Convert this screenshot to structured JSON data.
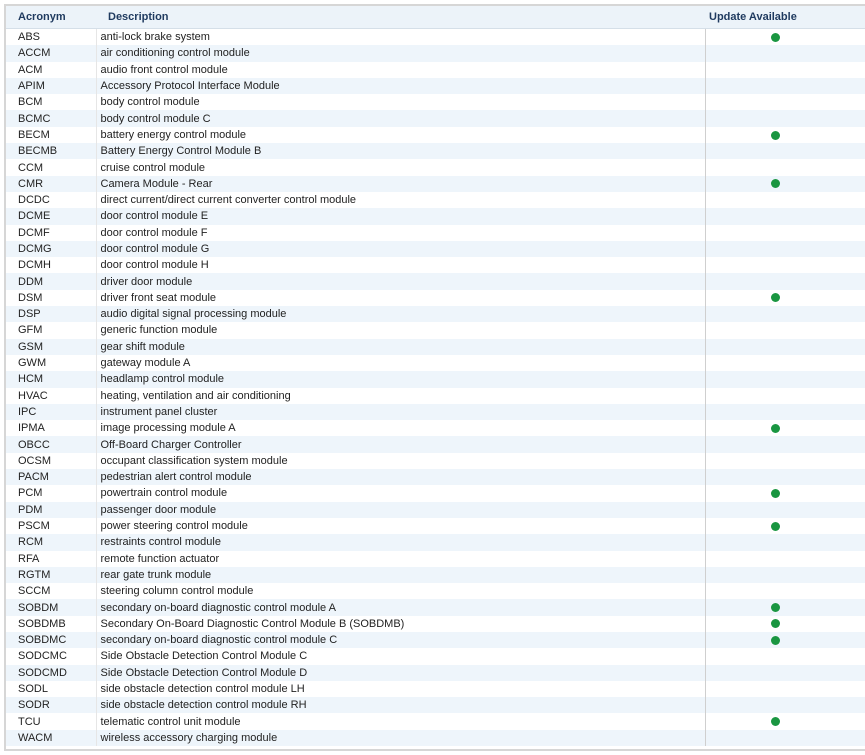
{
  "table": {
    "headers": {
      "acronym": "Acronym",
      "description": "Description",
      "update": "Update Available"
    },
    "update_indicator_color": "#1a9641",
    "rows": [
      {
        "acronym": "ABS",
        "description": "anti-lock brake system",
        "update": true
      },
      {
        "acronym": "ACCM",
        "description": "air conditioning control module",
        "update": false
      },
      {
        "acronym": "ACM",
        "description": "audio front control module",
        "update": false
      },
      {
        "acronym": "APIM",
        "description": "Accessory Protocol Interface Module",
        "update": false
      },
      {
        "acronym": "BCM",
        "description": "body control module",
        "update": false
      },
      {
        "acronym": "BCMC",
        "description": "body control module C",
        "update": false
      },
      {
        "acronym": "BECM",
        "description": "battery energy control module",
        "update": true
      },
      {
        "acronym": "BECMB",
        "description": "Battery Energy Control Module B",
        "update": false
      },
      {
        "acronym": "CCM",
        "description": "cruise control module",
        "update": false
      },
      {
        "acronym": "CMR",
        "description": "Camera Module - Rear",
        "update": true
      },
      {
        "acronym": "DCDC",
        "description": "direct current/direct current converter control module",
        "update": false
      },
      {
        "acronym": "DCME",
        "description": "door control module E",
        "update": false
      },
      {
        "acronym": "DCMF",
        "description": "door control module F",
        "update": false
      },
      {
        "acronym": "DCMG",
        "description": "door control module G",
        "update": false
      },
      {
        "acronym": "DCMH",
        "description": "door control module H",
        "update": false
      },
      {
        "acronym": "DDM",
        "description": "driver door module",
        "update": false
      },
      {
        "acronym": "DSM",
        "description": "driver front seat module",
        "update": true
      },
      {
        "acronym": "DSP",
        "description": "audio digital signal processing module",
        "update": false
      },
      {
        "acronym": "GFM",
        "description": "generic function module",
        "update": false
      },
      {
        "acronym": "GSM",
        "description": "gear shift module",
        "update": false
      },
      {
        "acronym": "GWM",
        "description": "gateway module A",
        "update": false
      },
      {
        "acronym": "HCM",
        "description": "headlamp control module",
        "update": false
      },
      {
        "acronym": "HVAC",
        "description": "heating, ventilation and air conditioning",
        "update": false
      },
      {
        "acronym": "IPC",
        "description": "instrument panel cluster",
        "update": false
      },
      {
        "acronym": "IPMA",
        "description": "image processing module A",
        "update": true
      },
      {
        "acronym": "OBCC",
        "description": "Off-Board Charger Controller",
        "update": false
      },
      {
        "acronym": "OCSM",
        "description": "occupant classification system module",
        "update": false
      },
      {
        "acronym": "PACM",
        "description": "pedestrian alert control module",
        "update": false
      },
      {
        "acronym": "PCM",
        "description": "powertrain control module",
        "update": true
      },
      {
        "acronym": "PDM",
        "description": "passenger door module",
        "update": false
      },
      {
        "acronym": "PSCM",
        "description": "power steering control module",
        "update": true
      },
      {
        "acronym": "RCM",
        "description": "restraints control module",
        "update": false
      },
      {
        "acronym": "RFA",
        "description": "remote function actuator",
        "update": false
      },
      {
        "acronym": "RGTM",
        "description": "rear gate trunk module",
        "update": false
      },
      {
        "acronym": "SCCM",
        "description": "steering column control module",
        "update": false
      },
      {
        "acronym": "SOBDM",
        "description": "secondary on-board diagnostic control module A",
        "update": true
      },
      {
        "acronym": "SOBDMB",
        "description": "Secondary On-Board Diagnostic Control Module B (SOBDMB)",
        "update": true
      },
      {
        "acronym": "SOBDMC",
        "description": "secondary on-board diagnostic control module C",
        "update": true
      },
      {
        "acronym": "SODCMC",
        "description": "Side Obstacle Detection Control Module C",
        "update": false
      },
      {
        "acronym": "SODCMD",
        "description": "Side Obstacle Detection Control Module D",
        "update": false
      },
      {
        "acronym": "SODL",
        "description": "side obstacle detection control module LH",
        "update": false
      },
      {
        "acronym": "SODR",
        "description": "side obstacle detection control module RH",
        "update": false
      },
      {
        "acronym": "TCU",
        "description": "telematic control unit module",
        "update": true
      },
      {
        "acronym": "WACM",
        "description": "wireless accessory charging module",
        "update": false
      }
    ]
  }
}
